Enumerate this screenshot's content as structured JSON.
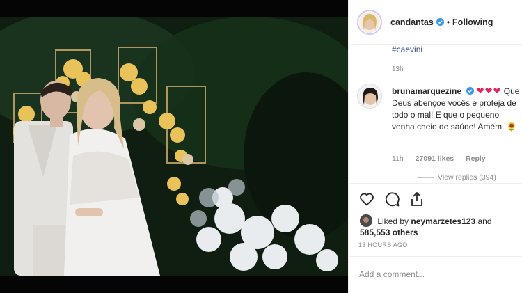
{
  "post": {
    "username": "candantas",
    "follow_status": "Following",
    "caption_hashtag": "#caevini",
    "caption_time": "13h"
  },
  "comment": {
    "username": "brunamarquezine",
    "hearts": "❤❤❤",
    "text": "Que Deus abençoe vocês e proteja de todo o mal! E que o pequeno venha cheio de saúde! Amém. 🌻",
    "time": "11h",
    "likes": "27091 likes",
    "reply": "Reply",
    "view_replies": "View replies (394)"
  },
  "likes": {
    "prefix": "Liked by",
    "user": "neymarzetes123",
    "and": "and",
    "others": "585,553 others"
  },
  "timestamp": "13 HOURS AGO",
  "add_comment_placeholder": "Add a comment...",
  "colors": {
    "link": "#385185",
    "verified": "#3897f0",
    "heart": "#e0245e",
    "muted": "#8e8e8e"
  },
  "icons": [
    "heart-icon",
    "comment-icon",
    "share-icon",
    "verified-icon"
  ]
}
